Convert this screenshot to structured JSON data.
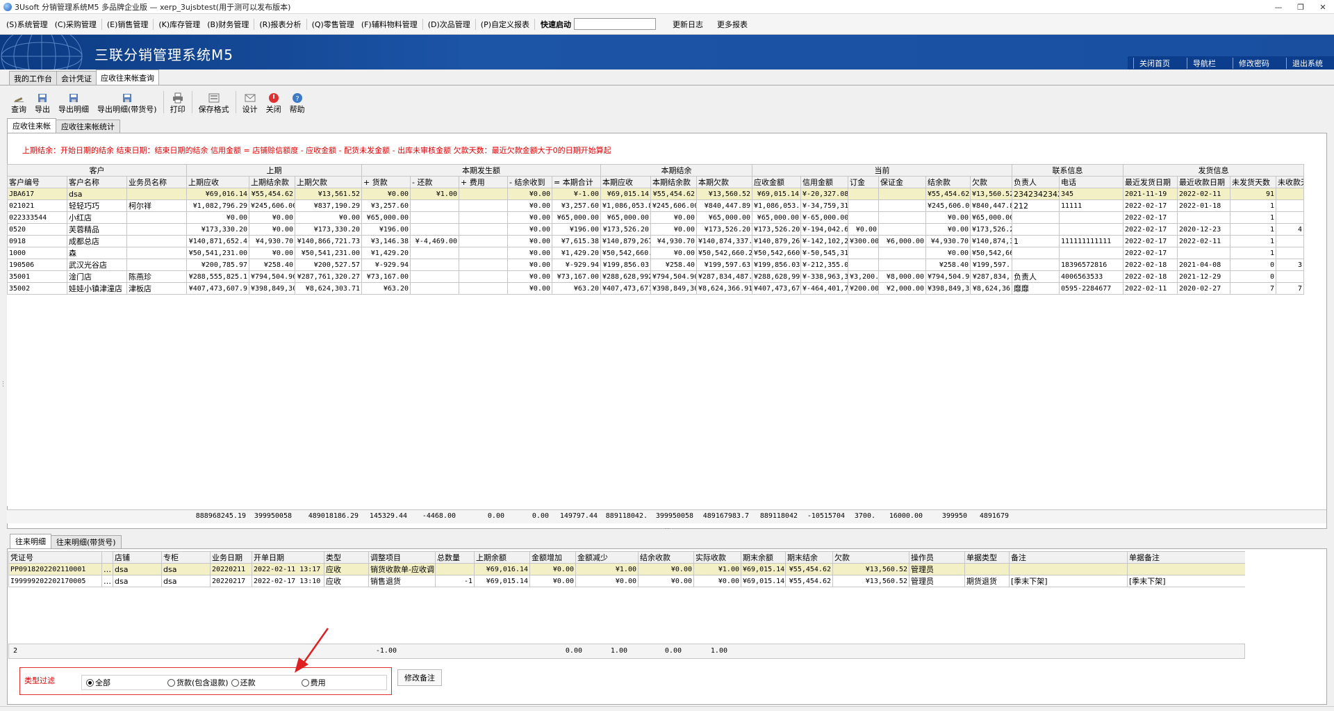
{
  "window": {
    "title": "3Usoft 分销管理系统M5 多品牌企业版 — xerp_3ujsbtest(用于测可以发布版本)",
    "min": "—",
    "max": "❐",
    "close": "✕"
  },
  "menu": {
    "items": [
      "(S)系统管理",
      "(C)采购管理",
      "(E)销售管理",
      "(K)库存管理",
      "(B)财务管理",
      "(R)报表分析",
      "(Q)零售管理",
      "(F)辅料物料管理",
      "(D)次品管理",
      "(P)自定义报表"
    ],
    "quick_start_label": "快速启动",
    "quick_start_value": "",
    "update_log": "更新日志",
    "more_reports": "更多报表"
  },
  "banner": {
    "title": "三联分销管理系统M5",
    "links": [
      "关闭首页",
      "导航栏",
      "修改密码",
      "退出系统"
    ]
  },
  "main_tabs": [
    "我的工作台",
    "会计凭证",
    "应收往来帐查询"
  ],
  "toolbar": [
    "查询",
    "导出",
    "导出明细",
    "导出明细(带货号)",
    "打印",
    "保存格式",
    "设计",
    "关闭",
    "帮助"
  ],
  "sub_tabs": [
    "应收往来帐",
    "应收往来帐统计"
  ],
  "legend": "上期结余：开始日期的结余   结束日期：结束日期的结余   信用金额 = 店铺赊信额度 - 应收金额 - 配货未发金额 - 出库未审核金额   欠款天数：最近欠款金额大于0的日期开始算起",
  "grid1": {
    "groups": [
      "客户",
      "上期",
      "本期发生额",
      "本期结余",
      "当前",
      "联系信息",
      "发货信息"
    ],
    "columns": [
      "客户编号",
      "客户名称",
      "业务员名称",
      "上期应收",
      "上期结余款",
      "上期欠款",
      "+ 货款",
      "- 还款",
      "+ 费用",
      "- 结余收到",
      "= 本期合计",
      "本期应收",
      "本期结余款",
      "本期欠款",
      "应收金额",
      "信用金额",
      "订金",
      "保证金",
      "结余款",
      "欠款",
      "负责人",
      "电话",
      "最近发货日期",
      "最近收款日期",
      "未发货天数",
      "未收款天"
    ],
    "rows": [
      [
        "JBA617",
        "dsa",
        "",
        "¥69,016.14",
        "¥55,454.62",
        "¥13,561.52",
        "¥0.00",
        "¥1.00",
        "",
        "¥0.00",
        "¥-1.00",
        "¥69,015.14",
        "¥55,454.62",
        "¥13,560.52",
        "¥69,015.14",
        "¥-20,327.08",
        "",
        "",
        "¥55,454.62",
        "¥13,560.52",
        "23423423423",
        "345",
        "2021-11-19",
        "2022-02-11",
        "91",
        ""
      ],
      [
        "021021",
        "轻轻巧巧",
        "柯尔祥",
        "¥1,082,796.29",
        "¥245,606.00",
        "¥837,190.29",
        "¥3,257.60",
        "",
        "",
        "¥0.00",
        "¥3,257.60",
        "¥1,086,053.89",
        "¥245,606.00",
        "¥840,447.89",
        "¥1,086,053.89",
        "¥-34,759,318",
        "",
        "",
        "¥245,606.00",
        "¥840,447.89",
        "212",
        "11111",
        "2022-02-17",
        "2022-01-18",
        "1",
        ""
      ],
      [
        "022333544",
        "小红店",
        "",
        "¥0.00",
        "¥0.00",
        "¥0.00",
        "¥65,000.00",
        "",
        "",
        "¥0.00",
        "¥65,000.00",
        "¥65,000.00",
        "¥0.00",
        "¥65,000.00",
        "¥65,000.00",
        "¥-65,000.00",
        "",
        "",
        "¥0.00",
        "¥65,000.00",
        "",
        "",
        "2022-02-17",
        "",
        "1",
        ""
      ],
      [
        "0520",
        "芙蓉精品",
        "",
        "¥173,330.20",
        "¥0.00",
        "¥173,330.20",
        "¥196.00",
        "",
        "",
        "¥0.00",
        "¥196.00",
        "¥173,526.20",
        "¥0.00",
        "¥173,526.20",
        "¥173,526.20",
        "¥-194,042.60",
        "¥0.00",
        "",
        "¥0.00",
        "¥173,526.20",
        "",
        "",
        "2022-02-17",
        "2020-12-23",
        "1",
        "4"
      ],
      [
        "0918",
        "成都总店",
        "",
        "¥140,871,652.4",
        "¥4,930.70",
        "¥140,866,721.73",
        "¥3,146.38",
        "¥-4,469.00",
        "",
        "¥0.00",
        "¥7,615.38",
        "¥140,879,267",
        "¥4,930.70",
        "¥140,874,337.",
        "¥140,879,26",
        "¥-142,102,2",
        "¥300.00",
        "¥6,000.00",
        "¥4,930.70",
        "¥140,874,3",
        "1",
        "111111111111",
        "2022-02-17",
        "2022-02-11",
        "1",
        ""
      ],
      [
        "1000",
        "森",
        "",
        "¥50,541,231.00",
        "¥0.00",
        "¥50,541,231.00",
        "¥1,429.20",
        "",
        "",
        "¥0.00",
        "¥1,429.20",
        "¥50,542,660.",
        "¥0.00",
        "¥50,542,660.2",
        "¥50,542,660",
        "¥-50,545,31",
        "",
        "",
        "¥0.00",
        "¥50,542,66",
        "",
        "",
        "2022-02-17",
        "",
        "1",
        ""
      ],
      [
        "190506",
        "武汉光谷店",
        "",
        "¥200,785.97",
        "¥258.40",
        "¥200,527.57",
        "¥-929.94",
        "",
        "",
        "¥0.00",
        "¥-929.94",
        "¥199,856.03",
        "¥258.40",
        "¥199,597.63",
        "¥199,856.03",
        "¥-212,355.0",
        "",
        "",
        "¥258.40",
        "¥199,597.",
        "",
        "18396572816",
        "2022-02-18",
        "2021-04-08",
        "0",
        "3"
      ],
      [
        "35001",
        "淦门店",
        "陈燕珍",
        "¥288,555,825.1",
        "¥794,504.90",
        "¥287,761,320.27",
        "¥73,167.00",
        "",
        "",
        "¥0.00",
        "¥73,167.00",
        "¥288,628,992",
        "¥794,504.90",
        "¥287,834,487.",
        "¥288,628,99",
        "¥-338,963,3",
        "¥3,200.",
        "¥8,000.00",
        "¥794,504.9",
        "¥287,834,",
        "负责人",
        "4006563533",
        "2022-02-18",
        "2021-12-29",
        "0",
        ""
      ],
      [
        "35002",
        "娃娃小镇津潼店",
        "津板店",
        "¥407,473,607.9",
        "¥398,849,30",
        "¥8,624,303.71",
        "¥63.20",
        "",
        "",
        "¥0.00",
        "¥63.20",
        "¥407,473,671",
        "¥398,849,30",
        "¥8,624,366.91",
        "¥407,473,67",
        "¥-464,401,7",
        "¥200.00",
        "¥2,000.00",
        "¥398,849,3",
        "¥8,624,36",
        "靡靡",
        "0595-2284677",
        "2022-02-11",
        "2020-02-27",
        "7",
        "7"
      ]
    ],
    "totals": [
      "888968245.19",
      "399950058",
      "489018186.29",
      "145329.44",
      "-4468.00",
      "0.00",
      "0.00",
      "149797.44",
      "889118042.",
      "399950058",
      "489167983.7",
      "889118042",
      "-10515704",
      "3700.",
      "16000.00",
      "399950",
      "4891679"
    ]
  },
  "bottom_tabs": [
    "往来明细",
    "往来明细(带货号)"
  ],
  "grid2": {
    "columns": [
      "凭证号",
      "",
      "店铺",
      "专柜",
      "业务日期",
      "开单日期",
      "类型",
      "调整项目",
      "总数量",
      "上期余额",
      "金额增加",
      "金额减少",
      "结余收款",
      "实际收款",
      "期末余额",
      "期末结余",
      "欠款",
      "操作员",
      "单据类型",
      "备注",
      "单据备注"
    ],
    "rows": [
      [
        "PP0918202202110001",
        "…",
        "dsa",
        "dsa",
        "20220211",
        "2022-02-11 13:17",
        "应收",
        "销货收款单-应收调",
        "",
        "¥69,016.14",
        "¥0.00",
        "¥1.00",
        "¥0.00",
        "¥1.00",
        "¥69,015.14",
        "¥55,454.62",
        "¥13,560.52",
        "管理员",
        "",
        "",
        ""
      ],
      [
        "I99999202202170005",
        "…",
        "dsa",
        "dsa",
        "20220217",
        "2022-02-17 13:10",
        "应收",
        "销售退货",
        "-1",
        "¥69,015.14",
        "¥0.00",
        "¥0.00",
        "¥0.00",
        "¥0.00",
        "¥69,015.14",
        "¥55,454.62",
        "¥13,560.52",
        "管理员",
        "期货退货",
        "[季末下架]",
        "[季末下架]"
      ]
    ],
    "totals": {
      "count": "2",
      "qty": "-1.00",
      "inc": "0.00",
      "dec": "1.00",
      "bal": "0.00",
      "recv": "1.00"
    }
  },
  "filter": {
    "label": "类型过滤",
    "options": [
      "全部",
      "货款(包含退款)",
      "还款",
      "费用"
    ],
    "selected": 0,
    "remark_button": "修改备注"
  }
}
